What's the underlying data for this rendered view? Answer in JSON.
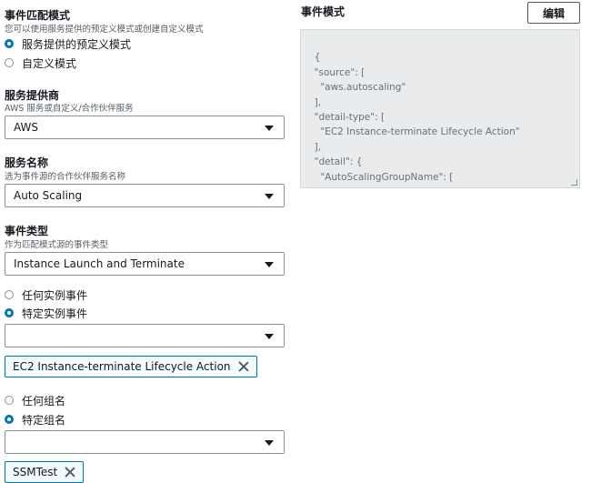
{
  "event_matching": {
    "title": "事件匹配模式",
    "description": "您可以使用服务提供的预定义模式或创建自定义模式",
    "options": [
      "服务提供的预定义模式",
      "自定义模式"
    ],
    "selected": "服务提供的预定义模式"
  },
  "service_provider": {
    "title": "服务提供商",
    "description": "AWS 服务或自定义/合作伙伴服务",
    "value": "AWS"
  },
  "service_name": {
    "title": "服务名称",
    "description": "选为事件源的合作伙伴服务名称",
    "value": "Auto Scaling"
  },
  "event_type": {
    "title": "事件类型",
    "description": "作为匹配模式源的事件类型",
    "value": "Instance Launch and Terminate"
  },
  "instance_events": {
    "options": [
      "任何实例事件",
      "特定实例事件"
    ],
    "selected": "特定实例事件",
    "dropdown_value": "",
    "token": "EC2 Instance-terminate Lifecycle Action"
  },
  "group_names": {
    "options": [
      "任何组名",
      "特定组名"
    ],
    "selected": "特定组名",
    "dropdown_value": "",
    "token": "SSMTest"
  },
  "event_pattern": {
    "title": "事件模式",
    "edit_label": "编辑",
    "code": "{\n  \"source\": [\n    \"aws.autoscaling\"\n  ],\n  \"detail-type\": [\n    \"EC2 Instance-terminate Lifecycle Action\"\n  ],\n  \"detail\": {\n    \"AutoScalingGroupName\": [\n      \"SSMTest\""
  },
  "colors": {
    "accent": "#0073bb",
    "token_bg": "#f1faff",
    "code_bg": "#e9ebed"
  }
}
